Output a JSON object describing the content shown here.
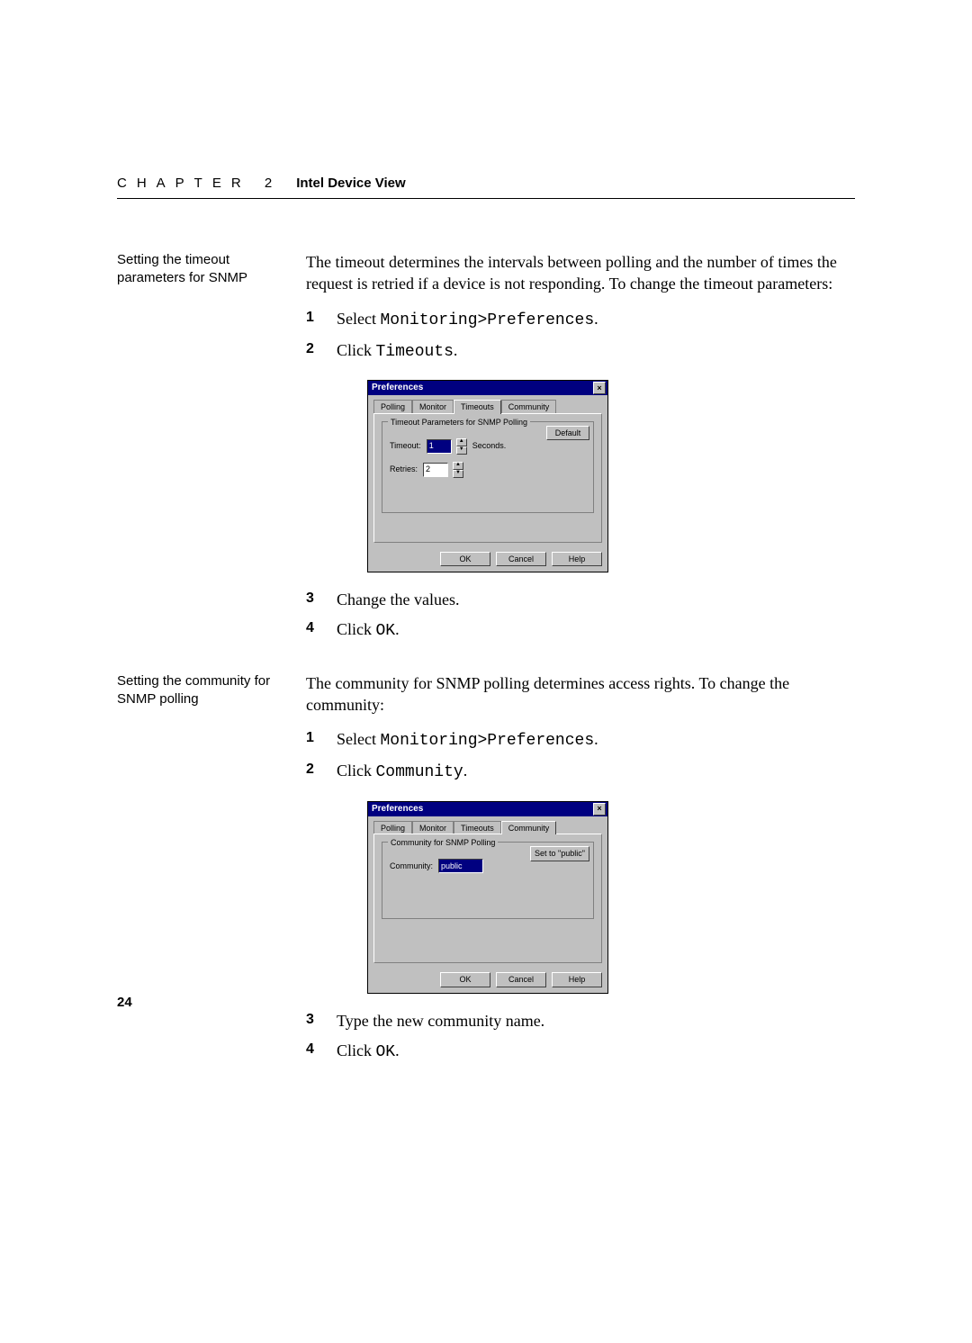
{
  "header": {
    "chapter_line": "CHAPTER 2",
    "title": "Intel Device View"
  },
  "section1": {
    "side": "Setting the timeout parameters for SNMP",
    "intro": "The timeout determines the intervals between polling and the number of times the request is retried if a device is not responding. To change the timeout parameters:",
    "steps": {
      "s1_pre": "Select ",
      "s1_code": "Monitoring>Preferences",
      "s1_post": ".",
      "s2_pre": "Click ",
      "s2_code": "Timeouts",
      "s2_post": ".",
      "s3": "Change the values.",
      "s4_pre": "Click ",
      "s4_code": "OK",
      "s4_post": "."
    }
  },
  "section2": {
    "side": "Setting the community for SNMP polling",
    "intro": "The community for SNMP polling determines access rights. To change the community:",
    "steps": {
      "s1_pre": "Select ",
      "s1_code": "Monitoring>Preferences",
      "s1_post": ".",
      "s2_pre": "Click ",
      "s2_code": "Community",
      "s2_post": ".",
      "s3": "Type the new community name.",
      "s4_pre": "Click ",
      "s4_code": "OK",
      "s4_post": "."
    }
  },
  "dialog1": {
    "title": "Preferences",
    "tabs": [
      "Polling",
      "Monitor",
      "Timeouts",
      "Community"
    ],
    "active_tab": "Timeouts",
    "group": "Timeout Parameters for SNMP Polling",
    "timeout_label": "Timeout:",
    "timeout_val": "1",
    "timeout_unit": "Seconds.",
    "retries_label": "Retries:",
    "retries_val": "2",
    "default": "Default",
    "ok": "OK",
    "cancel": "Cancel",
    "help": "Help"
  },
  "dialog2": {
    "title": "Preferences",
    "tabs": [
      "Polling",
      "Monitor",
      "Timeouts",
      "Community"
    ],
    "active_tab": "Community",
    "group": "Community for SNMP Polling",
    "community_label": "Community:",
    "community_val": "public",
    "setpublic": "Set to \"public\"",
    "ok": "OK",
    "cancel": "Cancel",
    "help": "Help"
  },
  "page_number": "24"
}
